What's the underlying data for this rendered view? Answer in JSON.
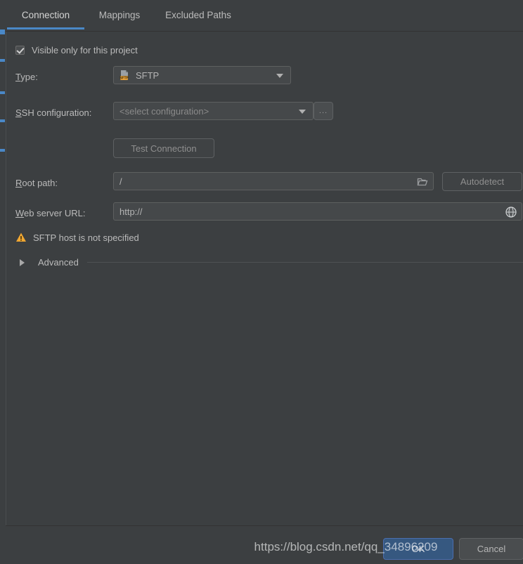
{
  "window": {
    "background": "#3c3f41",
    "accent": "#4a88c7"
  },
  "tabs": [
    {
      "label": "Connection",
      "active": true
    },
    {
      "label": "Mappings",
      "active": false
    },
    {
      "label": "Excluded Paths",
      "active": false
    }
  ],
  "form": {
    "visible_only_checkbox": {
      "label": "Visible only for this project",
      "checked": true
    },
    "type": {
      "label": "Type:",
      "mnemonic": "T",
      "value": "SFTP",
      "icon": "sftp-protocol-icon",
      "badge_text": "SFTP"
    },
    "ssh_configuration": {
      "label": "SSH configuration:",
      "mnemonic": "S",
      "value": "",
      "placeholder": "<select configuration>",
      "browse_button_label": "..."
    },
    "test_connection": {
      "label": "Test Connection",
      "enabled": false
    },
    "root_path": {
      "label": "Root path:",
      "mnemonic": "R",
      "value": "/",
      "icon": "folder-icon",
      "autodetect_label": "Autodetect"
    },
    "web_server_url": {
      "label": "Web server URL:",
      "mnemonic": "W",
      "value": "http://",
      "icon": "globe-icon"
    },
    "warning": {
      "icon": "warning-triangle-icon",
      "color": "#f0a732",
      "text": "SFTP host is not specified"
    },
    "advanced": {
      "label": "Advanced",
      "expanded": false,
      "icon": "chevron-right-icon"
    }
  },
  "footer": {
    "ok_label": "OK",
    "cancel_label": "Cancel",
    "ok_color": "#365880"
  },
  "watermark": {
    "text": "https://blog.csdn.net/qq_34896209"
  }
}
